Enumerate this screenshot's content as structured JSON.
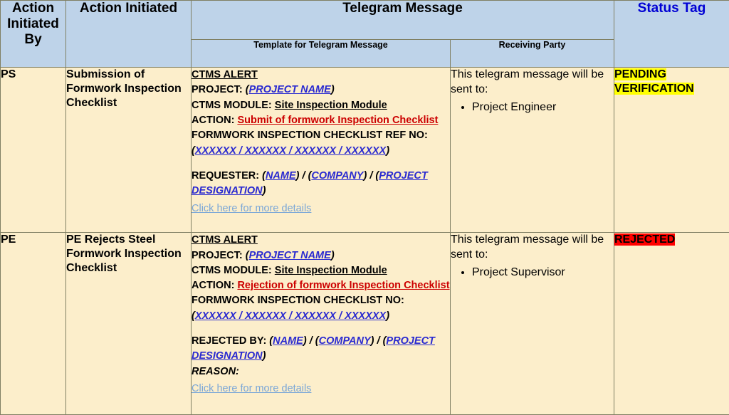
{
  "table": {
    "headers": {
      "action_initiated_by": "Action\nInitiated\nBy",
      "action_initiated_by_l1": "Action",
      "action_initiated_by_l2": "Initiated",
      "action_initiated_by_l3": "By",
      "action_initiated": "Action Initiated",
      "telegram_message": "Telegram Message",
      "template_for_telegram_message": "Template for Telegram Message",
      "receiving_party": "Receiving Party",
      "status_tag": "Status Tag"
    },
    "rows": [
      {
        "actor": "PS",
        "action": "Submission of Formwork Inspection Checklist",
        "message": {
          "alert_title": "CTMS ALERT",
          "project_label": "PROJECT: ",
          "project_value": "PROJECT NAME",
          "module_label": "CTMS MODULE: ",
          "module_value": "Site Inspection Module",
          "action_label": "ACTION: ",
          "action_value": "Submit of formwork Inspection Checklist",
          "ref_label": "FORMWORK INSPECTION CHECKLIST REF NO:",
          "ref_value": "XXXXXX / XXXXXX / XXXXXX / XXXXXX",
          "party_label": "REQUESTER:",
          "party_name": "NAME",
          "party_company": "COMPANY",
          "party_designation": "PROJECT DESIGNATION",
          "reason_label": "",
          "link": "Click here for more details"
        },
        "receiving": {
          "intro": "This telegram message will be sent to:",
          "recipients": [
            "Project Engineer"
          ]
        },
        "status": {
          "label": "PENDING VERIFICATION",
          "highlight": "#ffff00",
          "text_color": "#000000"
        }
      },
      {
        "actor": "PE",
        "action": "PE Rejects Steel Formwork Inspection Checklist",
        "message": {
          "alert_title": "CTMS ALERT",
          "project_label": "PROJECT: ",
          "project_value": "PROJECT NAME",
          "module_label": "CTMS MODULE: ",
          "module_value": "Site Inspection Module",
          "action_label": "ACTION: ",
          "action_value": "Rejection of formwork Inspection Checklist",
          "ref_label": "FORMWORK INSPECTION CHECKLIST NO:",
          "ref_value": "XXXXXX / XXXXXX / XXXXXX / XXXXXX",
          "party_label": "REJECTED BY:",
          "party_name": "NAME",
          "party_company": "COMPANY",
          "party_designation": "PROJECT DESIGNATION",
          "reason_label": "REASON:",
          "link": "Click here for more details"
        },
        "receiving": {
          "intro": "This telegram message will be sent to:",
          "recipients": [
            "Project Supervisor"
          ]
        },
        "status": {
          "label": "REJECTED",
          "highlight": "#ff0000",
          "text_color": "#000000"
        }
      }
    ]
  },
  "colors": {
    "header_bg": "#bed3e9",
    "body_bg": "#fceecb",
    "border": "#7f7f63",
    "status_tag_header": "#0000d4",
    "placeholder_blue": "#2a2ad0",
    "action_red": "#cc0000",
    "hyperlink_blue": "#7ba7d7"
  }
}
